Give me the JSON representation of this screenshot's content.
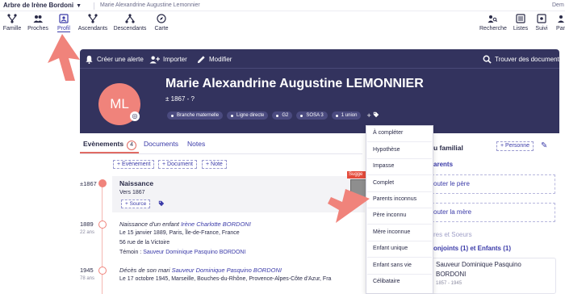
{
  "topbar": {
    "tree_title": "Arbre de Irène Bordoni",
    "breadcrumb": "Marie Alexandrine Augustine Lemonnier",
    "right_cut": "Dem"
  },
  "nav": {
    "left": [
      {
        "label": "Famille",
        "icon": "family-tree-icon"
      },
      {
        "label": "Proches",
        "icon": "people-icon"
      },
      {
        "label": "Profil",
        "icon": "profile-card-icon",
        "active": true
      },
      {
        "label": "Ascendants",
        "icon": "ascendants-icon"
      },
      {
        "label": "Descendants",
        "icon": "descendants-icon"
      },
      {
        "label": "Carte",
        "icon": "compass-icon"
      }
    ],
    "right": [
      {
        "label": "Recherche",
        "icon": "search-people-icon"
      },
      {
        "label": "Listes",
        "icon": "list-icon"
      },
      {
        "label": "Suivi",
        "icon": "eye-icon"
      },
      {
        "label": "Par",
        "icon": "partner-icon"
      }
    ]
  },
  "card": {
    "toolbar": {
      "alert": "Créer une alerte",
      "import": "Importer",
      "edit": "Modifier",
      "find_docs": "Trouver des documents"
    },
    "initials": "ML",
    "name": "Marie Alexandrine Augustine LEMONNIER",
    "dates": "± 1867 - ?",
    "tags": [
      "Branche maternelle",
      "Ligne directe",
      "G2",
      "SOSA 3",
      "1 union"
    ],
    "tags_more": "+",
    "colors": {
      "card_bg": "#33335e",
      "avatar": "#f0837b",
      "accent": "#3a3aa8"
    }
  },
  "tabs": {
    "events": "Evènements",
    "events_count": "4",
    "documents": "Documents",
    "notes": "Notes"
  },
  "add_buttons": {
    "event": "+ Evènement",
    "document": "+ Document",
    "note": "+ Note"
  },
  "events": [
    {
      "year": "±1867",
      "age": "",
      "title": "Naissance",
      "line1": "Vers 1867",
      "source_btn": "+ Source"
    },
    {
      "year": "1889",
      "age": "22 ans",
      "title": "Naissance d'un enfant",
      "title_link": "Irène Charlotte BORDONI",
      "line1": "Le 15 janvier 1889, Paris, Île-de-France, France",
      "line2": "56 rue de la Victoire",
      "line3_prefix": "Témoin : ",
      "line3_link": "Sauveur Dominique Pasquino BORDONI"
    },
    {
      "year": "1945",
      "age": "78 ans",
      "title": "Décès de son mari",
      "title_link": "Sauveur Dominique Pasquino BORDONI",
      "line1": "Le 17 octobre 1945, Marseille, Bouches-du-Rhône, Provence-Alpes-Côte d'Azur, Fra"
    }
  ],
  "suggestion_label": "Sugge",
  "dropdown": {
    "items": [
      "À compléter",
      "Hypothèse",
      "Impasse",
      "Complet",
      "Parents inconnus",
      "Père inconnu",
      "Mère inconnue",
      "Enfant unique",
      "Enfant sans vie",
      "Célibataire"
    ]
  },
  "right_panel": {
    "title": "u familial",
    "add_person": "+ Personne",
    "parents": "arents",
    "add_father": "outer le père",
    "add_mother": "outer la mère",
    "siblings": "res et Soeurs",
    "spouses": "onjoints (1) et Enfants (1)",
    "spouse_name_1": "Sauveur Dominique Pasquino",
    "spouse_name_2": "BORDONI",
    "spouse_dates": "1857 - 1945"
  }
}
